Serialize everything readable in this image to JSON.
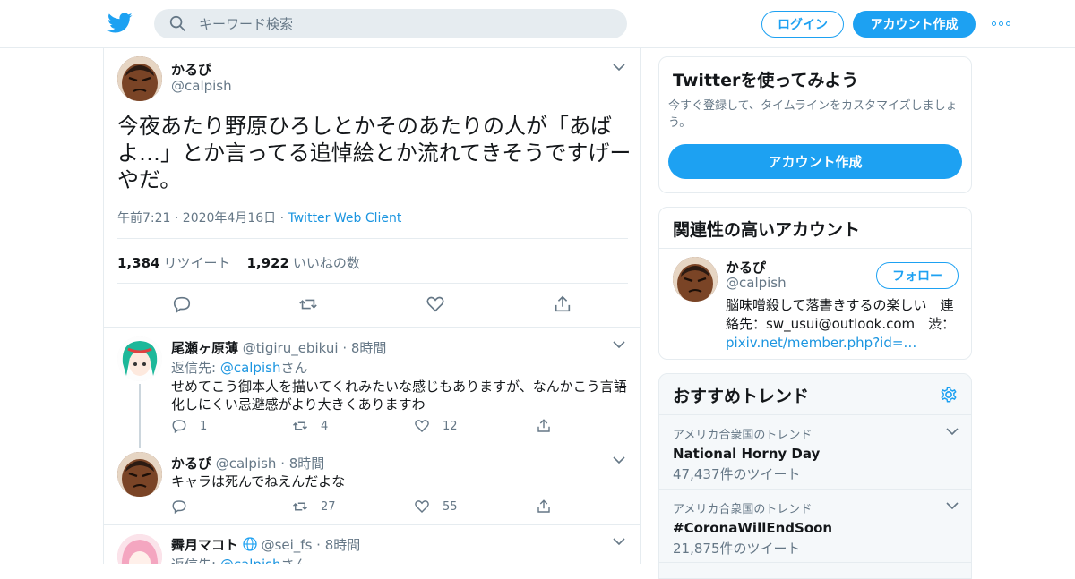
{
  "header": {
    "search_placeholder": "キーワード検索",
    "login_label": "ログイン",
    "signup_label": "アカウント作成"
  },
  "tweet": {
    "name": "かるぴ",
    "handle": "@calpish",
    "text": "今夜あたり野原ひろしとかそのあたりの人が「あばよ…」とか言ってる追悼絵とか流れてきそうですげーやだ。",
    "timestamp": "午前7:21 · 2020年4月16日",
    "separator": " · ",
    "client": "Twitter Web Client",
    "retweets": "1,384",
    "retweets_label": "リツイート",
    "likes": "1,922",
    "likes_label": "いいねの数"
  },
  "replies": [
    {
      "name": "尾瀬ヶ原薄",
      "handle": "@tigiru_ebikui",
      "time": "8時間",
      "reply_to_prefix": "返信先: ",
      "reply_to": "@calpish",
      "reply_to_suffix": "さん",
      "text": "せめてこう御本人を描いてくれみたいな感じもありますが、なんかこう言語化しにくい忌避感がより大きくありますわ",
      "reply_count": "1",
      "retweet_count": "4",
      "like_count": "12"
    },
    {
      "name": "かるぴ",
      "handle": "@calpish",
      "time": "8時間",
      "text": "キャラは死んでねえんだよな",
      "reply_count": "",
      "retweet_count": "27",
      "like_count": "55"
    },
    {
      "name": "霽月マコト",
      "handle": "@sei_fs",
      "time": "8時間",
      "reply_to_prefix": "返信先: ",
      "reply_to": "@calpish",
      "reply_to_suffix": "さん"
    }
  ],
  "sidebar": {
    "signup_card": {
      "title": "Twitterを使ってみよう",
      "description": "今すぐ登録して、タイムラインをカスタマイズしましょう。",
      "button": "アカウント作成"
    },
    "related_card": {
      "title": "関連性の高いアカウント",
      "name": "かるぴ",
      "handle": "@calpish",
      "follow_label": "フォロー",
      "bio": "脳味噌殺して落書きするの楽しい　連絡先：sw_usui@outlook.com　渋：",
      "bio_link": "pixiv.net/member.php?id=…"
    },
    "trends_card": {
      "title": "おすすめトレンド",
      "trends": [
        {
          "context": "アメリカ合衆国のトレンド",
          "title": "National Horny Day",
          "count": "47,437件のツイート"
        },
        {
          "context": "アメリカ合衆国のトレンド",
          "title": "#CoronaWillEndSoon",
          "count": "21,875件のツイート"
        }
      ]
    }
  },
  "colors": {
    "accent": "#1da1f2",
    "link": "#1b95e0",
    "muted": "#657786",
    "border": "#e6ecf0"
  }
}
